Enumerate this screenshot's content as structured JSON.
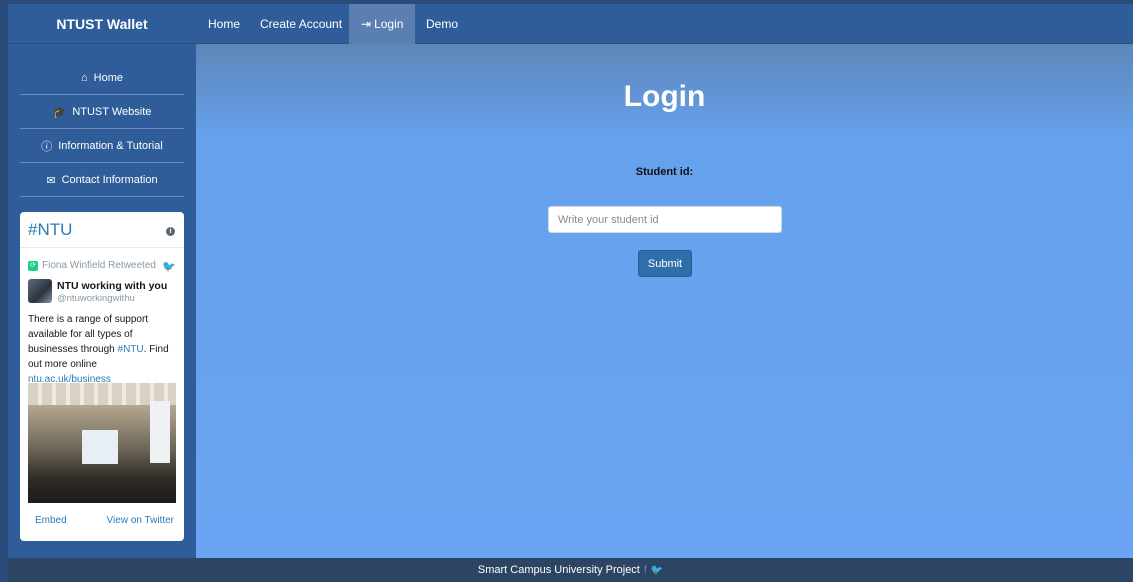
{
  "navbar": {
    "brand": "NTUST Wallet",
    "items": [
      {
        "label": "Home"
      },
      {
        "label": "Create Account"
      },
      {
        "label": "Login",
        "active": true
      },
      {
        "label": "Demo"
      }
    ]
  },
  "sidebar": {
    "items": [
      {
        "label": "Home",
        "icon": "home-icon"
      },
      {
        "label": "NTUST Website",
        "icon": "graduation-cap-icon"
      },
      {
        "label": "Information & Tutorial",
        "icon": "info-circle-icon"
      },
      {
        "label": "Contact Information",
        "icon": "envelope-icon"
      }
    ]
  },
  "twitter": {
    "title": "#NTU",
    "retweet_text": "Fiona Winfield Retweeted",
    "name": "NTU working with you",
    "handle": "@ntuworkingwithu",
    "text_before": "There is a range of support available for all types of businesses through ",
    "hashtag": "#NTU",
    "text_middle": ". Find out more online ",
    "link": "ntu.ac.uk/business",
    "embed": "Embed",
    "view": "View on Twitter"
  },
  "main": {
    "title": "Login",
    "field_label": "Student id:",
    "input_placeholder": "Write your student id",
    "input_value": "",
    "submit_label": "Submit"
  },
  "footer": {
    "text": "Smart Campus University Project"
  },
  "colors": {
    "navbar": "#2f5d9a",
    "active_nav": "#5b7fb0",
    "main_bg": "#6aa4f2",
    "button": "#2f6ea8",
    "footer": "#2c4564"
  }
}
